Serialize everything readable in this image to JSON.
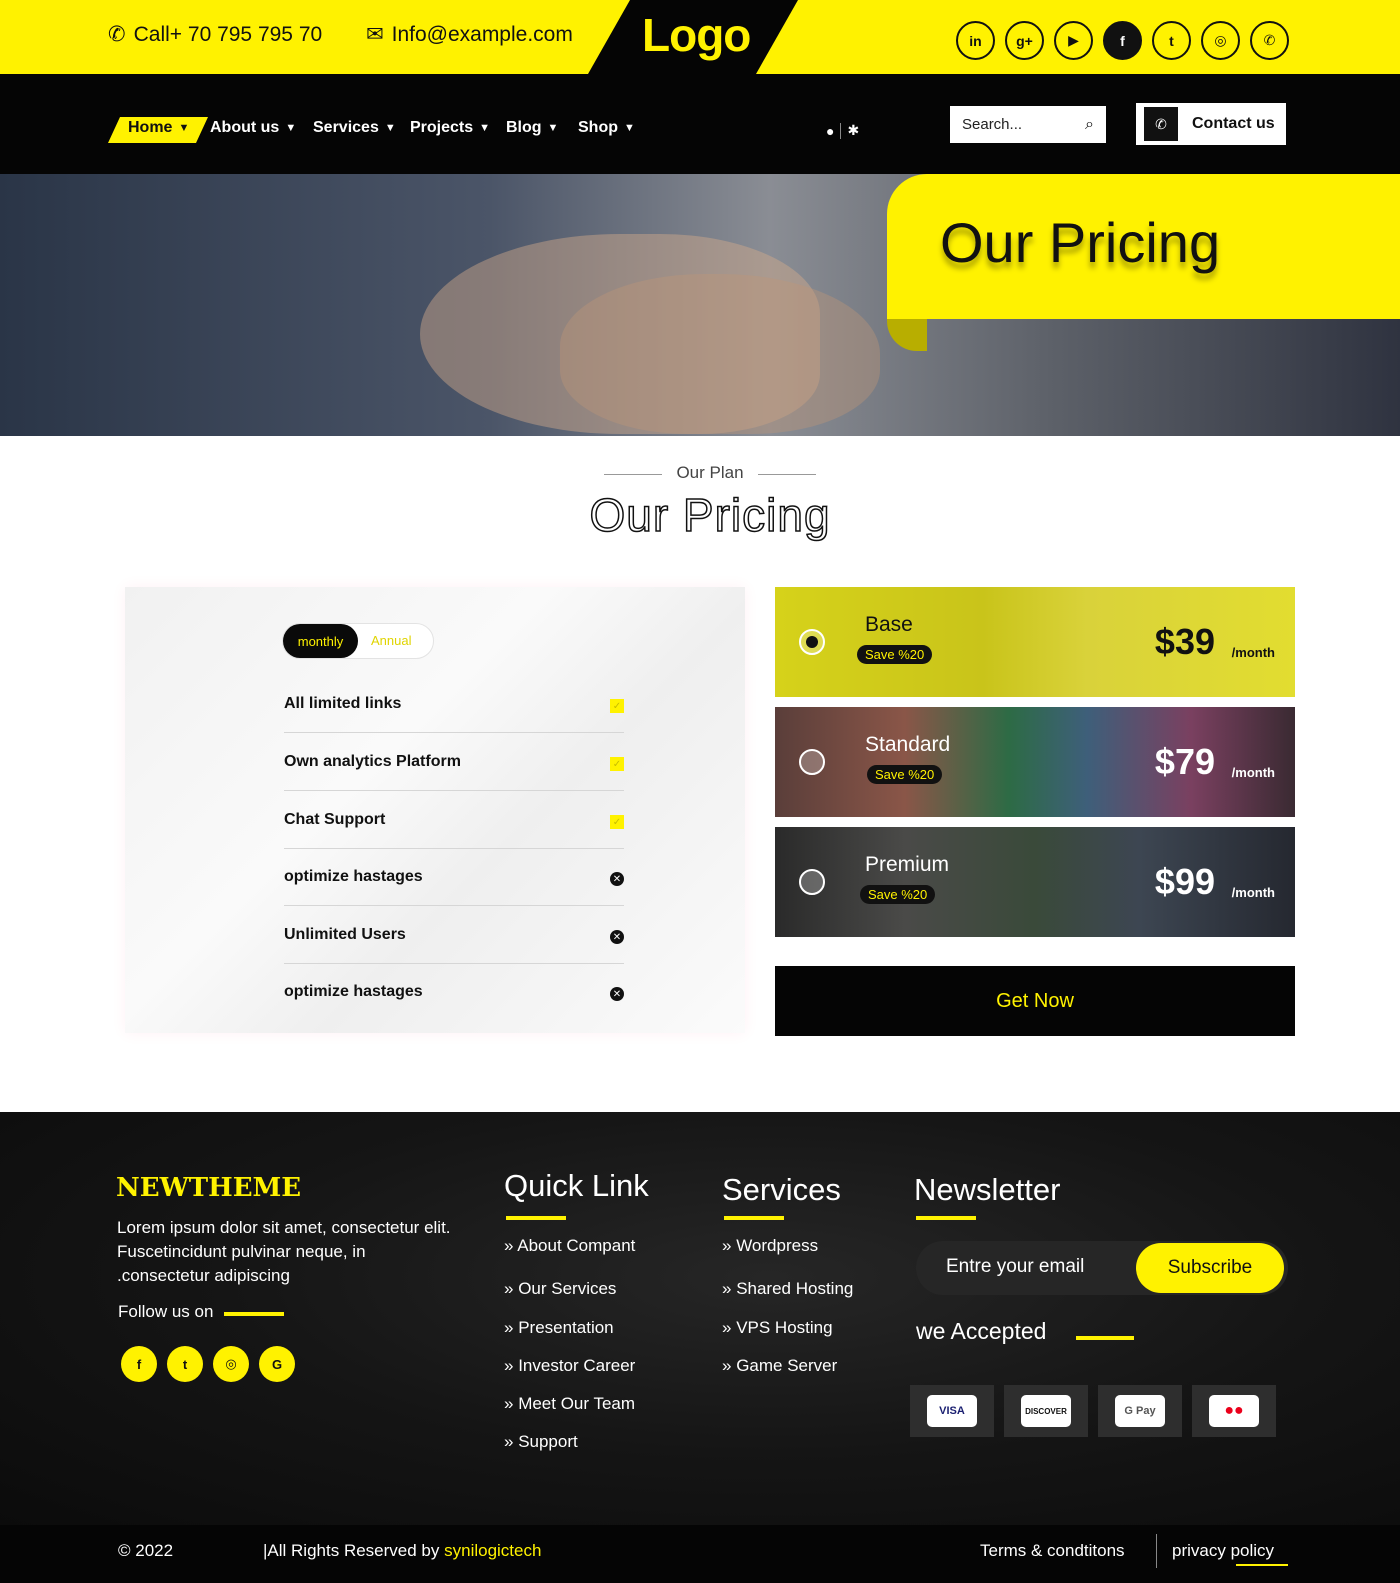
{
  "topbar": {
    "phone": "Call+ 70 795 795 70",
    "email": "Info@example.com",
    "logo": "Logo",
    "socials": [
      {
        "icon": "linkedin-icon",
        "glyph": "in"
      },
      {
        "icon": "google-plus-icon",
        "glyph": "g+"
      },
      {
        "icon": "youtube-icon",
        "glyph": "▶"
      },
      {
        "icon": "facebook-icon",
        "glyph": "f"
      },
      {
        "icon": "twitter-icon",
        "glyph": "t"
      },
      {
        "icon": "instagram-icon",
        "glyph": "◎"
      },
      {
        "icon": "whatsapp-icon",
        "glyph": "✆"
      }
    ]
  },
  "nav": {
    "items": [
      "Home",
      "About us",
      "Services",
      "Projects",
      "Blog",
      "Shop"
    ],
    "search_placeholder": "Search...",
    "contact_label": "Contact us"
  },
  "hero": {
    "title": "Our Pricing"
  },
  "section": {
    "subtitle": "Our Plan",
    "title": "Our Pricing"
  },
  "billing_toggle": {
    "active": "monthly",
    "inactive": "Annual"
  },
  "features": [
    {
      "label": "All limited links",
      "included": true
    },
    {
      "label": "Own analytics Platform",
      "included": true
    },
    {
      "label": "Chat Support",
      "included": true
    },
    {
      "label": "optimize hastages",
      "included": false
    },
    {
      "label": "Unlimited Users",
      "included": false
    },
    {
      "label": "optimize hastages",
      "included": false
    }
  ],
  "plans": [
    {
      "name": "Base",
      "save": "Save %20",
      "price": "$39",
      "period": "/month",
      "selected": true
    },
    {
      "name": "Standard",
      "save": "Save %20",
      "price": "$79",
      "period": "/month",
      "selected": false
    },
    {
      "name": "Premium",
      "save": "Save %20",
      "price": "$99",
      "period": "/month",
      "selected": false
    }
  ],
  "cta": "Get Now",
  "footer": {
    "brand": "NEWTHEME",
    "about": "Lorem ipsum dolor sit amet, consectetur elit. Fuscetincidunt pulvinar neque, in .consectetur adipiscing",
    "follow": "Follow us on",
    "follow_socials": [
      "f",
      "t",
      "◎",
      "G"
    ],
    "quick_title": "Quick Link",
    "quick_links": [
      "About Compant",
      "Our Services",
      "Presentation",
      "Investor Career",
      "Meet Our Team",
      "Support"
    ],
    "services_title": "Services",
    "services_links": [
      "Wordpress",
      "Shared Hosting",
      "VPS Hosting",
      "Game Server"
    ],
    "newsletter_title": "Newsletter",
    "email_placeholder": "Entre your email",
    "subscribe": "Subscribe",
    "accepted": "we Accepted",
    "payments": [
      "VISA",
      "DISCOVER",
      "G Pay",
      "●●"
    ],
    "copyright": "© 2022",
    "rights_prefix": "|All Rights Reserved by ",
    "rights_brand": "synilogictech",
    "terms": "Terms & condtitons",
    "privacy": "privacy policy"
  },
  "colors": {
    "accent": "#fff200",
    "dark": "#050505"
  }
}
